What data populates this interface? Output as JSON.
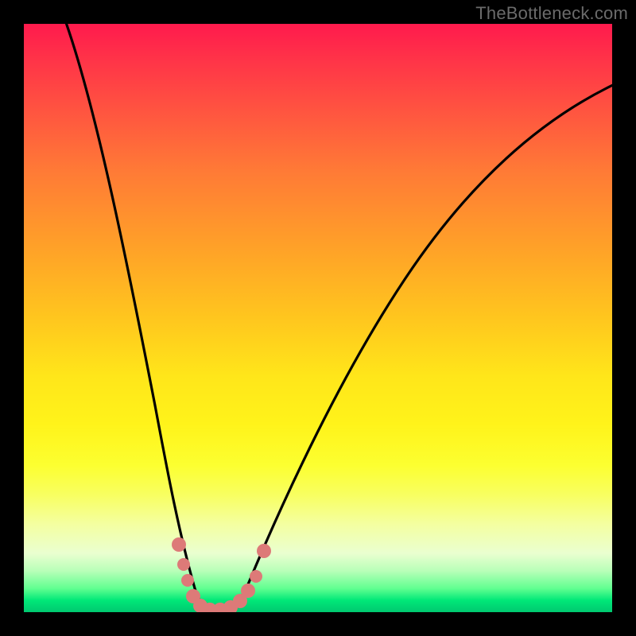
{
  "watermark": "TheBottleneck.com",
  "chart_data": {
    "type": "line",
    "title": "",
    "xlabel": "",
    "ylabel": "",
    "xlim": [
      0,
      100
    ],
    "ylim": [
      0,
      100
    ],
    "grid": false,
    "legend": false,
    "background_gradient": {
      "top": "#ff1a4d",
      "mid": "#ffe61a",
      "bottom": "#00c870",
      "meaning": "bottleneck severity (red=high, green=low)"
    },
    "series": [
      {
        "name": "bottleneck-curve",
        "color": "#000000",
        "x": [
          5,
          10,
          15,
          18,
          21,
          24,
          26,
          28,
          30,
          32,
          34,
          36,
          40,
          45,
          50,
          55,
          60,
          65,
          70,
          75,
          80,
          85,
          90,
          95,
          100
        ],
        "y": [
          100,
          80,
          55,
          40,
          25,
          12,
          6,
          2,
          0,
          0,
          1,
          3,
          10,
          22,
          33,
          42,
          50,
          56,
          62,
          66,
          70,
          73,
          76,
          78,
          80
        ]
      },
      {
        "name": "highlight-dots",
        "color": "#e57373",
        "type": "scatter",
        "x": [
          24.5,
          25.5,
          26.5,
          28,
          29.5,
          31,
          32.5,
          34,
          35.5,
          37
        ],
        "y": [
          10,
          7,
          4,
          1,
          0,
          0,
          0.5,
          2,
          5,
          10
        ]
      }
    ],
    "optimal_x": 30,
    "annotations": []
  }
}
